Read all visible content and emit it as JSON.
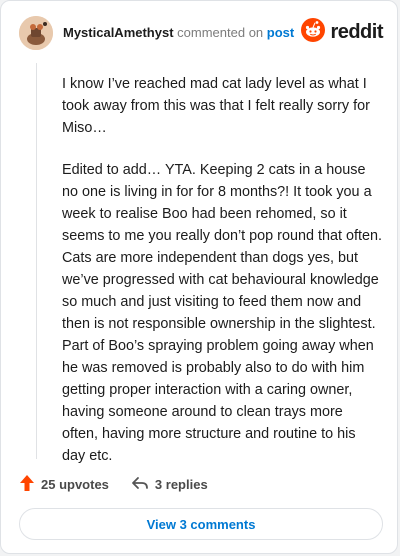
{
  "comment": {
    "author": "MysticalAmethyst",
    "action_text": "commented on",
    "target_link": "post",
    "paragraphs": [
      "I know I’ve reached mad cat lady level as what I took away from this was that I felt really sorry for Miso…",
      "Edited to add… YTA. Keeping 2 cats in a house no one is living in for for 8 months?! It took you a week to realise Boo had been rehomed, so it seems to me you really don’t pop round that often. Cats are more independent than dogs yes, but we’ve progressed with cat behavioural knowledge so much and just visiting to feed them now and then is not responsible ownership in the slightest. Part of Boo’s spraying problem going away when he was removed is probably also to do with him getting proper interaction with a caring owner, having someone around to clean trays more often, having more structure and routine to his day etc."
    ],
    "upvotes_label": "25 upvotes",
    "replies_label": "3 replies"
  },
  "brand": {
    "wordmark": "reddit",
    "icon": "reddit-snoo-icon",
    "color": "#ff4500"
  },
  "footer": {
    "view_comments_label": "View 3 comments"
  },
  "colors": {
    "link": "#0079d3",
    "upvote": "#ff4500",
    "text": "#1c1c1c"
  }
}
